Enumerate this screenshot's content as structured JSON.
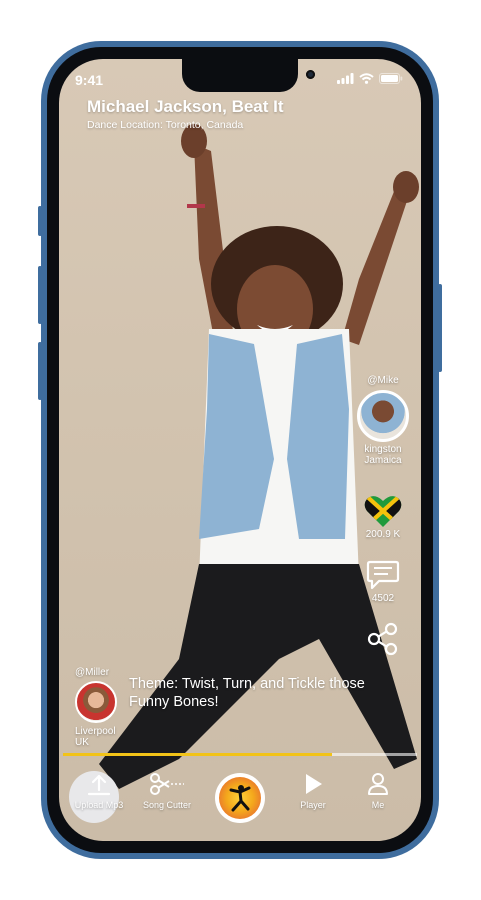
{
  "status_bar": {
    "time": "9:41"
  },
  "header": {
    "title": "Michael Jackson, Beat It",
    "subtitle": "Dance Location: Toronto, Canada"
  },
  "right_panel": {
    "creator_handle": "@Mike",
    "creator_location_city": "kingston",
    "creator_location_country": "Jamaica",
    "likes": "200.9 K",
    "comments": "4502",
    "flag": "jamaica-flag-heart"
  },
  "left_panel": {
    "user_handle": "@Miller",
    "user_location_city": "Liverpool",
    "user_location_country": "UK"
  },
  "theme_text": "Theme: Twist, Turn, and Tickle those Funny Bones!",
  "progress": {
    "fraction": 0.76,
    "color": "#f2c318"
  },
  "bottom_nav": {
    "upload": "Upload Mp3",
    "cutter": "Song Cutter",
    "player": "Player",
    "me": "Me"
  },
  "colors": {
    "frame": "#3f6d9e",
    "background": "#d6c7b3"
  }
}
